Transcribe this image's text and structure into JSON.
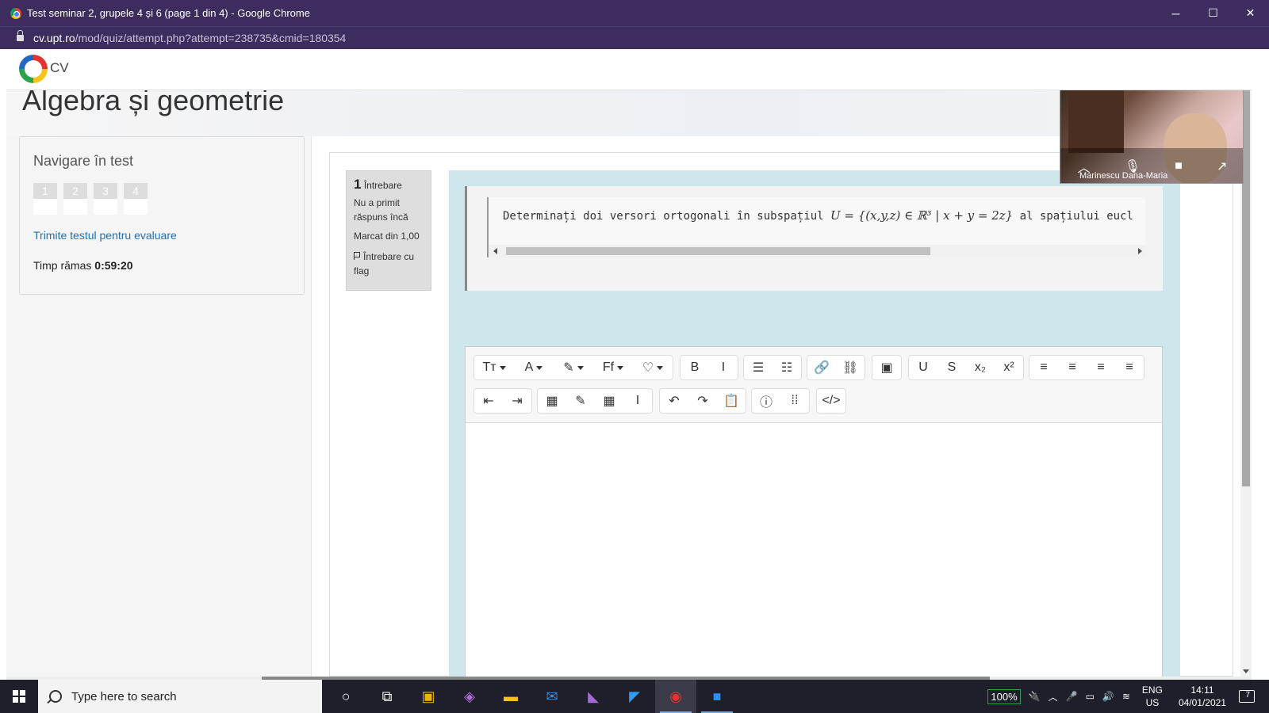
{
  "window": {
    "title": "Test seminar 2, grupele 4 și 6 (page 1 din 4) - Google Chrome",
    "minimize": "─",
    "maximize": "☐",
    "close": "✕"
  },
  "address": {
    "domain": "cv.upt.ro",
    "path": "/mod/quiz/attempt.php?attempt=238735&cmid=180354"
  },
  "site": {
    "logo_text": "CV",
    "course_title": "Algebra și geometrie"
  },
  "quiz_nav": {
    "title": "Navigare în test",
    "questions": [
      "1",
      "2",
      "3",
      "4"
    ],
    "submit_link": "Trimite testul pentru evaluare",
    "time_label": "Timp rămas",
    "time_value": "0:59:20"
  },
  "question_info": {
    "number": "1",
    "label": "Întrebare",
    "status": "Nu a primit răspuns încă",
    "marked": "Marcat din 1,00",
    "flag": "Întrebare cu flag"
  },
  "question": {
    "text_before": "Determinați doi versori ortogonali în subspațiul ",
    "math": "U = {(x,y,z) ∈ ℝ³ | x + y = 2z}",
    "text_after": " al spațiului eucl"
  },
  "editor": {
    "row1": [
      {
        "name": "paragraph-style-button",
        "glyph": "Tт",
        "caret": true
      },
      {
        "name": "font-color-button",
        "glyph": "A",
        "caret": true
      },
      {
        "name": "background-color-button",
        "glyph": "✎",
        "caret": true
      },
      {
        "name": "font-family-button",
        "glyph": "Ff",
        "caret": true
      },
      {
        "name": "highlight-button",
        "glyph": "♡",
        "caret": true
      },
      {
        "name": "bold-button",
        "glyph": "B"
      },
      {
        "name": "italic-button",
        "glyph": "I"
      },
      {
        "name": "unordered-list-button",
        "glyph": "☰"
      },
      {
        "name": "ordered-list-button",
        "glyph": "☷"
      },
      {
        "name": "link-button",
        "glyph": "🔗"
      },
      {
        "name": "unlink-button",
        "glyph": "⛓"
      },
      {
        "name": "image-button",
        "glyph": "▣"
      },
      {
        "name": "underline-button",
        "glyph": "U"
      },
      {
        "name": "strikethrough-button",
        "glyph": "S"
      },
      {
        "name": "subscript-button",
        "glyph": "x₂"
      },
      {
        "name": "superscript-button",
        "glyph": "x²"
      },
      {
        "name": "align-left-button",
        "glyph": "≡"
      },
      {
        "name": "align-center-button",
        "glyph": "≡"
      },
      {
        "name": "align-right-button",
        "glyph": "≡"
      },
      {
        "name": "align-justify-button",
        "glyph": "≡"
      }
    ],
    "row2": [
      {
        "name": "outdent-button",
        "glyph": "⇤"
      },
      {
        "name": "indent-button",
        "glyph": "⇥"
      },
      {
        "name": "equation-button",
        "glyph": "▦"
      },
      {
        "name": "edit-button",
        "glyph": "✎"
      },
      {
        "name": "table-button",
        "glyph": "▦"
      },
      {
        "name": "clear-format-button",
        "glyph": "I"
      },
      {
        "name": "undo-button",
        "glyph": "↶"
      },
      {
        "name": "redo-button",
        "glyph": "↷"
      },
      {
        "name": "paste-button",
        "glyph": "📋"
      },
      {
        "name": "accessibility-button",
        "glyph": "ⓘ"
      },
      {
        "name": "screenreader-button",
        "glyph": "⁞⁞"
      },
      {
        "name": "html-button",
        "glyph": "</>"
      }
    ]
  },
  "zoom": {
    "participant": "Marinescu Dana-Maria"
  },
  "taskbar": {
    "search_placeholder": "Type here to search",
    "battery": "100%",
    "lang1": "ENG",
    "lang2": "US",
    "time": "14:11",
    "date": "04/01/2021",
    "notifications": "7"
  }
}
